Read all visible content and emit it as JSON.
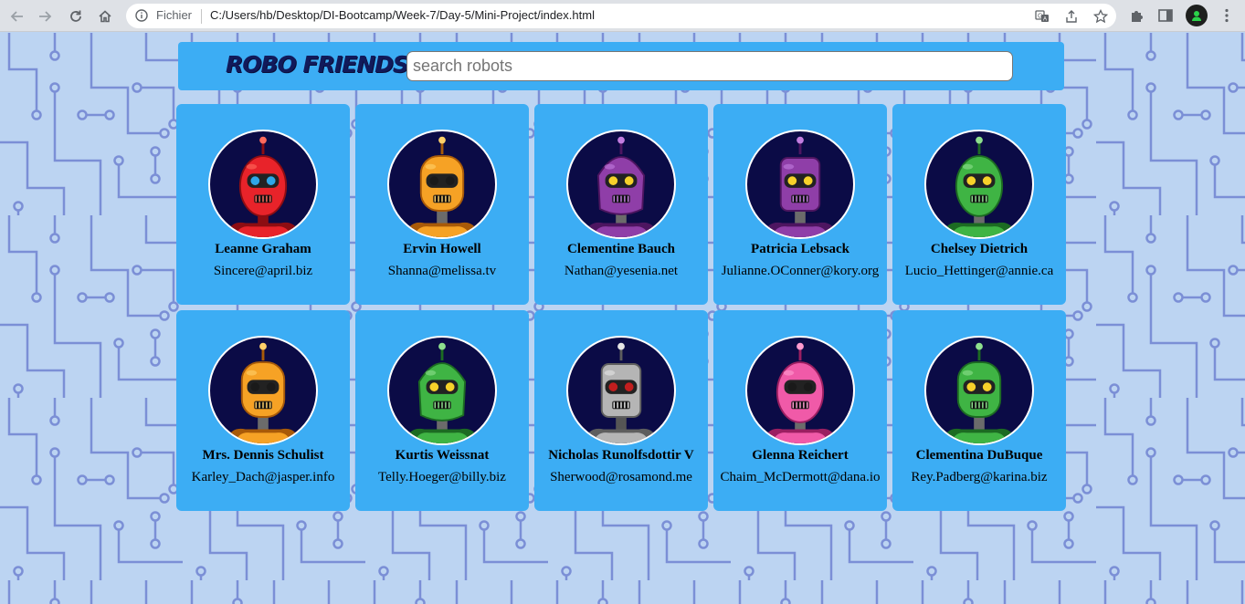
{
  "browser": {
    "scheme_label": "Fichier",
    "url": "C:/Users/hb/Desktop/DI-Bootcamp/Week-7/Day-5/Mini-Project/index.html",
    "icons": [
      "back-arrow-icon",
      "forward-arrow-icon",
      "reload-icon",
      "home-icon",
      "info-icon",
      "translate-icon",
      "share-icon",
      "bookmark-star-icon",
      "extensions-puzzle-icon",
      "side-panel-icon",
      "profile-avatar-icon",
      "kebab-menu-icon"
    ]
  },
  "header": {
    "logo": "ROBO FRIENDS",
    "search_placeholder": "search robots",
    "search_value": ""
  },
  "colors": {
    "card": "#3cadf4",
    "avatar_bg": "#0b0b46",
    "logo": "#111a5a",
    "page_bg": "#bcd4f2",
    "circuit": "#7b8fd6"
  },
  "robots": [
    {
      "name": "Leanne Graham",
      "email": "Sincere@april.biz",
      "color": "red"
    },
    {
      "name": "Ervin Howell",
      "email": "Shanna@melissa.tv",
      "color": "orange"
    },
    {
      "name": "Clementine Bauch",
      "email": "Nathan@yesenia.net",
      "color": "purple"
    },
    {
      "name": "Patricia Lebsack",
      "email": "Julianne.OConner@kory.org",
      "color": "purple"
    },
    {
      "name": "Chelsey Dietrich",
      "email": "Lucio_Hettinger@annie.ca",
      "color": "green"
    },
    {
      "name": "Mrs. Dennis Schulist",
      "email": "Karley_Dach@jasper.info",
      "color": "orange"
    },
    {
      "name": "Kurtis Weissnat",
      "email": "Telly.Hoeger@billy.biz",
      "color": "green"
    },
    {
      "name": "Nicholas Runolfsdottir V",
      "email": "Sherwood@rosamond.me",
      "color": "grey"
    },
    {
      "name": "Glenna Reichert",
      "email": "Chaim_McDermott@dana.io",
      "color": "pink"
    },
    {
      "name": "Clementina DuBuque",
      "email": "Rey.Padberg@karina.biz",
      "color": "green"
    }
  ]
}
